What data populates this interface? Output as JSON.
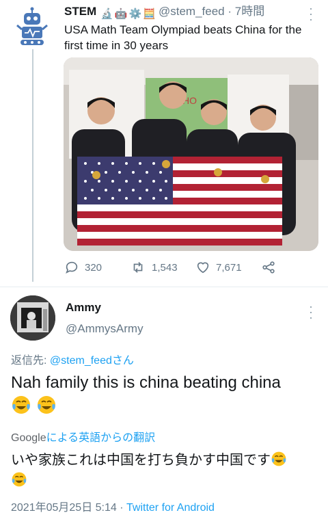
{
  "parent_tweet": {
    "author_name": "STEM",
    "author_emojis": [
      "🔬",
      "🤖",
      "⚙️",
      "🧮"
    ],
    "handle": "@stem_feed",
    "separator": "·",
    "time": "7時間",
    "text": "USA Math Team Olympiad beats China for the first time in 30 years",
    "photo_sign": "ICHO",
    "stats": {
      "replies": "320",
      "retweets": "1,543",
      "likes": "7,671"
    }
  },
  "reply_tweet": {
    "author_name": "Ammy",
    "handle": "@AmmysArmy",
    "replying_prefix": "返信先: ",
    "replying_to": "@stem_feed",
    "replying_suffix": "さん",
    "text": "Nah family this is china beating china",
    "translate_brand": "Google",
    "translate_label": "による英語からの翻訳",
    "translated_text": "いや家族これは中国を打ち負かす中国です",
    "date": "2021年05月25日 5:14",
    "meta_sep": " · ",
    "source": "Twitter for Android"
  },
  "colors": {
    "accent": "#1da1f2",
    "muted": "#657786",
    "thread": "#c4cfd6"
  }
}
